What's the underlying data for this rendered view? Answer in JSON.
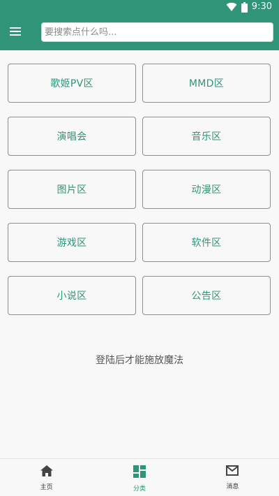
{
  "status_bar": {
    "time": "9:30",
    "icons": [
      "wifi-icon",
      "battery-icon"
    ]
  },
  "app_bar": {
    "menu_icon": "menu-icon",
    "search": {
      "placeholder": "要搜索点什么吗...",
      "value": ""
    }
  },
  "categories": [
    {
      "label": "歌姬PV区"
    },
    {
      "label": "MMD区"
    },
    {
      "label": "演唱会"
    },
    {
      "label": "音乐区"
    },
    {
      "label": "图片区"
    },
    {
      "label": "动漫区"
    },
    {
      "label": "游戏区"
    },
    {
      "label": "软件区"
    },
    {
      "label": "小说区"
    },
    {
      "label": "公告区"
    }
  ],
  "login_message": "登陆后才能施放魔法",
  "bottom_nav": [
    {
      "label": "主页",
      "icon": "home-icon",
      "active": false
    },
    {
      "label": "分类",
      "icon": "dashboard-icon",
      "active": true
    },
    {
      "label": "消息",
      "icon": "mail-icon",
      "active": false
    }
  ],
  "colors": {
    "primary": "#2f9478",
    "background": "#f7f8f7",
    "border": "#8e8e8e"
  }
}
